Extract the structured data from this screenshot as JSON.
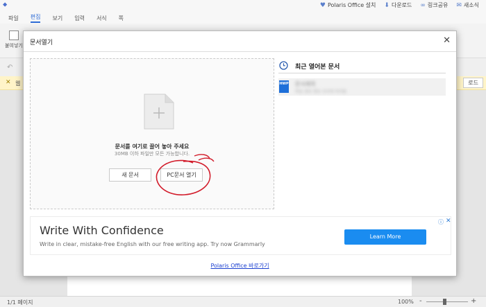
{
  "app": {
    "tabs": [
      "파일",
      "편집",
      "보기",
      "입력",
      "서식",
      "쪽"
    ],
    "active_tab": "편집",
    "top_actions": [
      {
        "icon": "polaris-logo-icon",
        "label": "Polaris Office 설치"
      },
      {
        "icon": "download-icon",
        "label": "다운로드"
      },
      {
        "icon": "link-icon",
        "label": "링크공유"
      },
      {
        "icon": "new-doc-icon",
        "label": "새소식"
      }
    ],
    "paste_label": "붙여넣기",
    "notice_button": "로드",
    "notice_text": "웹"
  },
  "dialog": {
    "title": "문서열기",
    "drop_title": "문서를 여기로 끌어 놓아 주세요",
    "drop_sub": "30MB 이하 파일만 모든 가능합니다.",
    "new_button": "새 문서",
    "open_button": "PC문서 열기",
    "recent_title": "최근 열어본 문서",
    "recent_items": [
      {
        "icon": "HWP",
        "name": "문서제목",
        "path": "파일 경로 정보 흐리게 처리됨"
      }
    ],
    "shortcut_link": "Polaris Office 바로가기"
  },
  "ad": {
    "title": "Write With Confidence",
    "description": "Write in clear, mistake-free English with our free writing app. Try now Grammarly",
    "button": "Learn More",
    "info_icon": "ⓘ",
    "close_icon": "✕"
  },
  "status": {
    "page": "1/1 페이지",
    "zoom": "100%",
    "zoom_minus": "-",
    "zoom_plus": "+"
  },
  "colors": {
    "accent": "#2c6bd6",
    "ad_button": "#1a8cf0",
    "link": "#1a3fd0",
    "annotation": "#d21b2a"
  }
}
